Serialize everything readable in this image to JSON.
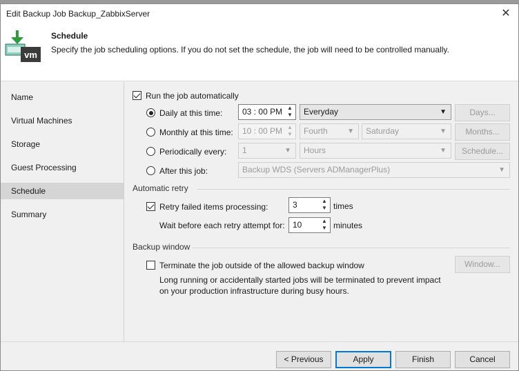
{
  "window": {
    "title": "Edit Backup Job Backup_ZabbixServer",
    "close_glyph": "✕"
  },
  "header": {
    "title": "Schedule",
    "description": "Specify the job scheduling options. If you do not set the schedule, the job will need to be controlled manually.",
    "logo_text": "vm"
  },
  "nav": {
    "items": [
      "Name",
      "Virtual Machines",
      "Storage",
      "Guest Processing",
      "Schedule",
      "Summary"
    ],
    "active": "Schedule"
  },
  "schedule": {
    "run_automatically": {
      "label": "Run the job automatically",
      "checked": true
    },
    "daily": {
      "label": "Daily at this time:",
      "time_hour": "03",
      "time_sep": ":",
      "time_min": "00",
      "time_ampm": "PM",
      "option": "Everyday",
      "button": "Days...",
      "selected": true
    },
    "monthly": {
      "label": "Monthly at this time:",
      "time": "10 : 00 PM",
      "week": "Fourth",
      "day": "Saturday",
      "button": "Months..."
    },
    "periodically": {
      "label": "Periodically every:",
      "value": "1",
      "unit": "Hours",
      "button": "Schedule..."
    },
    "after_job": {
      "label": "After this job:",
      "value": "Backup WDS (Servers ADManagerPlus)"
    }
  },
  "retry": {
    "title": "Automatic retry",
    "retry_failed": {
      "label": "Retry failed items processing:",
      "checked": true,
      "value": "3",
      "unit": "times"
    },
    "wait": {
      "label": "Wait before each retry attempt for:",
      "value": "10",
      "unit": "minutes"
    }
  },
  "window_section": {
    "title": "Backup window",
    "terminate": {
      "label": "Terminate the job outside of the allowed backup window",
      "checked": false
    },
    "button": "Window...",
    "note_line1": "Long running or accidentally started jobs will be terminated to prevent impact",
    "note_line2": "on your production infrastructure during busy hours."
  },
  "footer": {
    "previous": "< Previous",
    "apply": "Apply",
    "finish": "Finish",
    "cancel": "Cancel"
  },
  "colors": {
    "accent": "#0078d7",
    "arrow_green": "#2e9c3a",
    "active_nav": "#d5d5d5"
  }
}
